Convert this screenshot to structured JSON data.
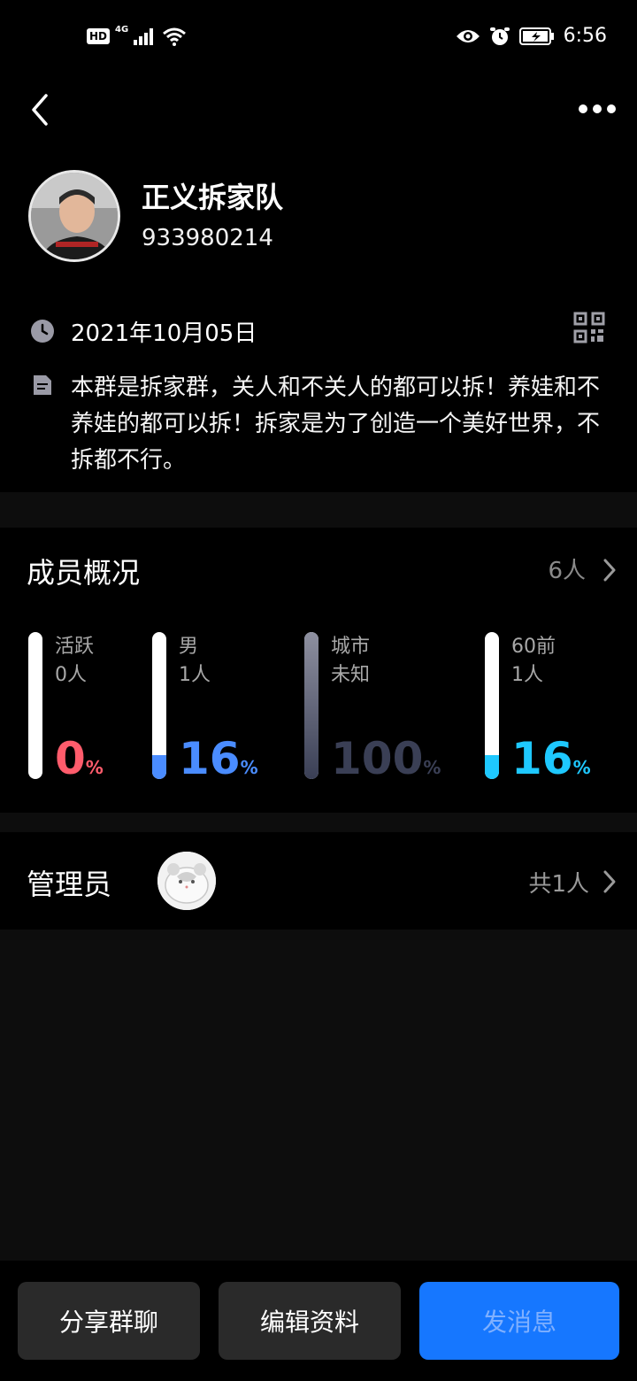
{
  "status_bar": {
    "hd": "HD",
    "network": "4G",
    "time": "6:56",
    "icons": [
      "signal-icon",
      "wifi-icon",
      "eye-icon",
      "alarm-icon",
      "battery-icon"
    ]
  },
  "header": {
    "back_icon": "chevron-left-icon",
    "more_icon": "more-horizontal-icon"
  },
  "group": {
    "name": "正义拆家队",
    "id": "933980214",
    "created_date": "2021年10月05日",
    "description": "本群是拆家群，关人和不关人的都可以拆！养娃和不养娃的都可以拆！拆家是为了创造一个美好世界，不拆都不行。"
  },
  "overview": {
    "title": "成员概况",
    "member_count": "6人",
    "stats": [
      {
        "label": "活跃",
        "sub": "0人",
        "percent": "0",
        "unit": "%",
        "fill": 0,
        "color": "#ff5c6c"
      },
      {
        "label": "男",
        "sub": "1人",
        "percent": "16",
        "unit": "%",
        "fill": 0.16,
        "color": "#4a8cff"
      },
      {
        "label": "城市",
        "sub": "未知",
        "percent": "100",
        "unit": "%",
        "fill": 1.0,
        "color": "#3a3f55"
      },
      {
        "label": "60前",
        "sub": "1人",
        "percent": "16",
        "unit": "%",
        "fill": 0.16,
        "color": "#1ec8ff"
      }
    ]
  },
  "admins": {
    "title": "管理员",
    "count": "共1人"
  },
  "actions": {
    "share": "分享群聊",
    "edit": "编辑资料",
    "send": "发消息"
  }
}
